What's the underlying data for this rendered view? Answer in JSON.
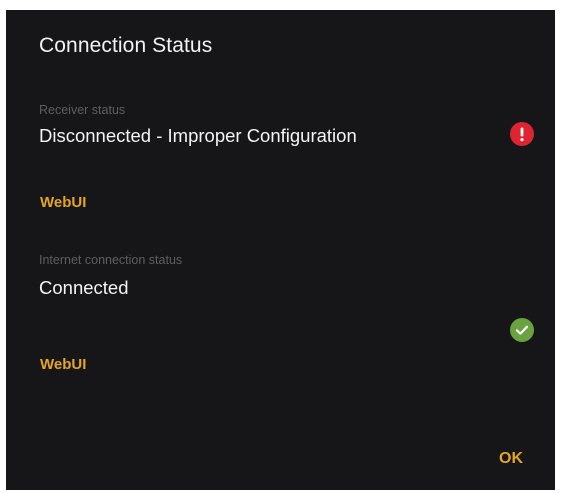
{
  "dialog": {
    "title": "Connection Status",
    "receiver": {
      "caption": "Receiver status",
      "status": "Disconnected - Improper Configuration",
      "link_label": "WebUI",
      "icon": "error-icon",
      "icon_color": "#e0242f"
    },
    "internet": {
      "caption": "Internet connection status",
      "status": "Connected",
      "link_label": "WebUI",
      "icon": "check-circle-icon",
      "icon_color": "#6aa240"
    },
    "ok_label": "OK",
    "accent_color": "#e4a522"
  }
}
